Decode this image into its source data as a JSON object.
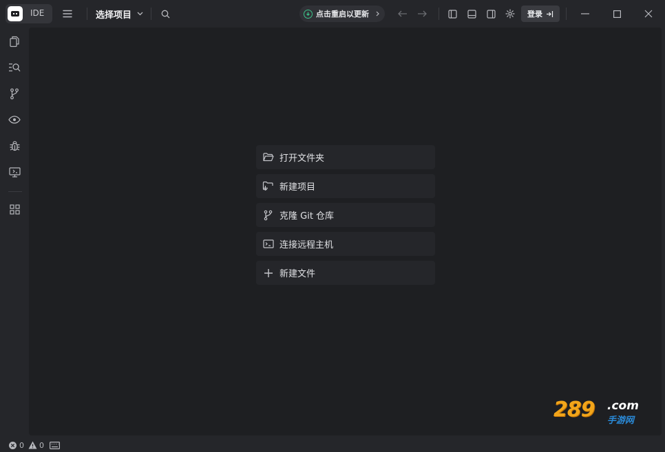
{
  "app": {
    "logo_label": "IDE",
    "project_select": "选择项目",
    "update_label": "点击重启以更新",
    "login_label": "登录"
  },
  "welcome_actions": [
    {
      "label": "打开文件夹",
      "icon": "folder-open-icon"
    },
    {
      "label": "新建项目",
      "icon": "new-project-icon"
    },
    {
      "label": "克隆 Git 仓库",
      "icon": "git-branch-icon"
    },
    {
      "label": "连接远程主机",
      "icon": "terminal-icon"
    },
    {
      "label": "新建文件",
      "icon": "plus-icon"
    }
  ],
  "activity_bar": [
    {
      "name": "explorer",
      "icon": "files-icon"
    },
    {
      "name": "search",
      "icon": "search-list-icon"
    },
    {
      "name": "source-control",
      "icon": "git-branch-icon"
    },
    {
      "name": "preview",
      "icon": "eye-icon"
    },
    {
      "name": "debug",
      "icon": "bug-icon"
    },
    {
      "name": "remote",
      "icon": "remote-monitor-icon"
    },
    {
      "name": "extensions",
      "icon": "grid-icon"
    }
  ],
  "status": {
    "errors": "0",
    "warnings": "0"
  },
  "watermark": {
    "number": "289",
    "domain": ".com",
    "sub": "手游网"
  },
  "colors": {
    "background": "#25262a",
    "editor": "#1e1f22",
    "card": "#25262a",
    "update_accent": "#3cc48a"
  }
}
